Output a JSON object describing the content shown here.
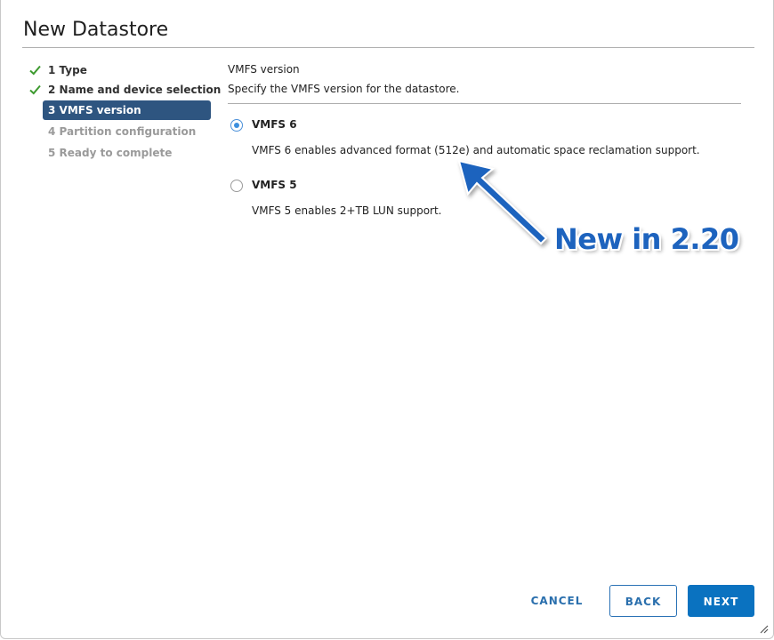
{
  "dialog": {
    "title": "New Datastore"
  },
  "steps": [
    {
      "label": "1 Type",
      "state": "done"
    },
    {
      "label": "2 Name and device selection",
      "state": "done"
    },
    {
      "label": "3 VMFS version",
      "state": "active"
    },
    {
      "label": "4 Partition configuration",
      "state": "pending"
    },
    {
      "label": "5 Ready to complete",
      "state": "pending"
    }
  ],
  "section": {
    "title": "VMFS version",
    "subtitle": "Specify the VMFS version for the datastore."
  },
  "options": [
    {
      "label": "VMFS 6",
      "description": "VMFS 6 enables advanced format (512e) and automatic space reclamation support.",
      "selected": true
    },
    {
      "label": "VMFS 5",
      "description": "VMFS 5 enables 2+TB LUN support.",
      "selected": false
    }
  ],
  "annotation": {
    "text": "New in 2.20",
    "color": "#1d63be"
  },
  "footer": {
    "cancel_label": "CANCEL",
    "back_label": "BACK",
    "next_label": "NEXT"
  },
  "colors": {
    "active_step": "#2e5580",
    "check": "#3d9a2f",
    "primary_button": "#0a72c0",
    "link": "#2a6fad"
  },
  "icons": {
    "completed_step": "check-icon",
    "resize": "resize-grip-icon"
  }
}
